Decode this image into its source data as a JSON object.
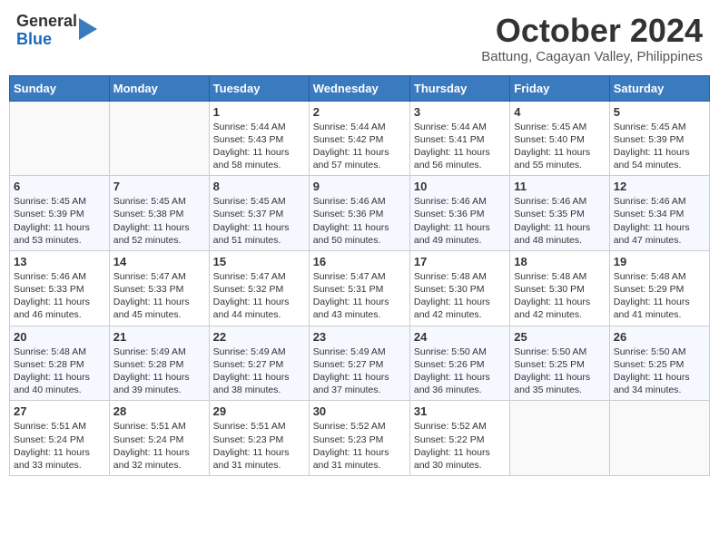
{
  "header": {
    "logo": {
      "general": "General",
      "blue": "Blue"
    },
    "title": "October 2024",
    "subtitle": "Battung, Cagayan Valley, Philippines"
  },
  "days_of_week": [
    "Sunday",
    "Monday",
    "Tuesday",
    "Wednesday",
    "Thursday",
    "Friday",
    "Saturday"
  ],
  "weeks": [
    [
      {
        "day": "",
        "info": ""
      },
      {
        "day": "",
        "info": ""
      },
      {
        "day": "1",
        "info": "Sunrise: 5:44 AM\nSunset: 5:43 PM\nDaylight: 11 hours and 58 minutes."
      },
      {
        "day": "2",
        "info": "Sunrise: 5:44 AM\nSunset: 5:42 PM\nDaylight: 11 hours and 57 minutes."
      },
      {
        "day": "3",
        "info": "Sunrise: 5:44 AM\nSunset: 5:41 PM\nDaylight: 11 hours and 56 minutes."
      },
      {
        "day": "4",
        "info": "Sunrise: 5:45 AM\nSunset: 5:40 PM\nDaylight: 11 hours and 55 minutes."
      },
      {
        "day": "5",
        "info": "Sunrise: 5:45 AM\nSunset: 5:39 PM\nDaylight: 11 hours and 54 minutes."
      }
    ],
    [
      {
        "day": "6",
        "info": "Sunrise: 5:45 AM\nSunset: 5:39 PM\nDaylight: 11 hours and 53 minutes."
      },
      {
        "day": "7",
        "info": "Sunrise: 5:45 AM\nSunset: 5:38 PM\nDaylight: 11 hours and 52 minutes."
      },
      {
        "day": "8",
        "info": "Sunrise: 5:45 AM\nSunset: 5:37 PM\nDaylight: 11 hours and 51 minutes."
      },
      {
        "day": "9",
        "info": "Sunrise: 5:46 AM\nSunset: 5:36 PM\nDaylight: 11 hours and 50 minutes."
      },
      {
        "day": "10",
        "info": "Sunrise: 5:46 AM\nSunset: 5:36 PM\nDaylight: 11 hours and 49 minutes."
      },
      {
        "day": "11",
        "info": "Sunrise: 5:46 AM\nSunset: 5:35 PM\nDaylight: 11 hours and 48 minutes."
      },
      {
        "day": "12",
        "info": "Sunrise: 5:46 AM\nSunset: 5:34 PM\nDaylight: 11 hours and 47 minutes."
      }
    ],
    [
      {
        "day": "13",
        "info": "Sunrise: 5:46 AM\nSunset: 5:33 PM\nDaylight: 11 hours and 46 minutes."
      },
      {
        "day": "14",
        "info": "Sunrise: 5:47 AM\nSunset: 5:33 PM\nDaylight: 11 hours and 45 minutes."
      },
      {
        "day": "15",
        "info": "Sunrise: 5:47 AM\nSunset: 5:32 PM\nDaylight: 11 hours and 44 minutes."
      },
      {
        "day": "16",
        "info": "Sunrise: 5:47 AM\nSunset: 5:31 PM\nDaylight: 11 hours and 43 minutes."
      },
      {
        "day": "17",
        "info": "Sunrise: 5:48 AM\nSunset: 5:30 PM\nDaylight: 11 hours and 42 minutes."
      },
      {
        "day": "18",
        "info": "Sunrise: 5:48 AM\nSunset: 5:30 PM\nDaylight: 11 hours and 42 minutes."
      },
      {
        "day": "19",
        "info": "Sunrise: 5:48 AM\nSunset: 5:29 PM\nDaylight: 11 hours and 41 minutes."
      }
    ],
    [
      {
        "day": "20",
        "info": "Sunrise: 5:48 AM\nSunset: 5:28 PM\nDaylight: 11 hours and 40 minutes."
      },
      {
        "day": "21",
        "info": "Sunrise: 5:49 AM\nSunset: 5:28 PM\nDaylight: 11 hours and 39 minutes."
      },
      {
        "day": "22",
        "info": "Sunrise: 5:49 AM\nSunset: 5:27 PM\nDaylight: 11 hours and 38 minutes."
      },
      {
        "day": "23",
        "info": "Sunrise: 5:49 AM\nSunset: 5:27 PM\nDaylight: 11 hours and 37 minutes."
      },
      {
        "day": "24",
        "info": "Sunrise: 5:50 AM\nSunset: 5:26 PM\nDaylight: 11 hours and 36 minutes."
      },
      {
        "day": "25",
        "info": "Sunrise: 5:50 AM\nSunset: 5:25 PM\nDaylight: 11 hours and 35 minutes."
      },
      {
        "day": "26",
        "info": "Sunrise: 5:50 AM\nSunset: 5:25 PM\nDaylight: 11 hours and 34 minutes."
      }
    ],
    [
      {
        "day": "27",
        "info": "Sunrise: 5:51 AM\nSunset: 5:24 PM\nDaylight: 11 hours and 33 minutes."
      },
      {
        "day": "28",
        "info": "Sunrise: 5:51 AM\nSunset: 5:24 PM\nDaylight: 11 hours and 32 minutes."
      },
      {
        "day": "29",
        "info": "Sunrise: 5:51 AM\nSunset: 5:23 PM\nDaylight: 11 hours and 31 minutes."
      },
      {
        "day": "30",
        "info": "Sunrise: 5:52 AM\nSunset: 5:23 PM\nDaylight: 11 hours and 31 minutes."
      },
      {
        "day": "31",
        "info": "Sunrise: 5:52 AM\nSunset: 5:22 PM\nDaylight: 11 hours and 30 minutes."
      },
      {
        "day": "",
        "info": ""
      },
      {
        "day": "",
        "info": ""
      }
    ]
  ]
}
